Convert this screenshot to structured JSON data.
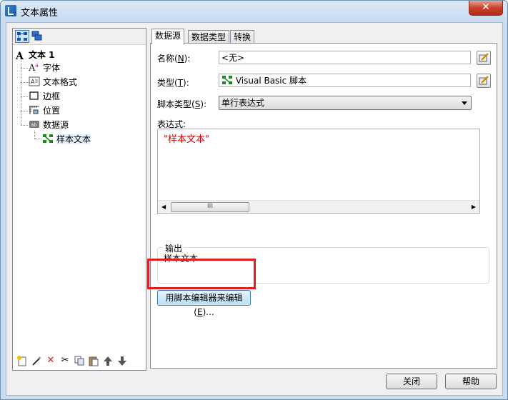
{
  "window": {
    "title": "文本属性",
    "close_glyph": "✕"
  },
  "left_toolbar": {
    "icons": [
      "tree-view-icon",
      "stack-view-icon"
    ]
  },
  "tree": {
    "root": "文本 1",
    "items": [
      {
        "label": "字体",
        "icon": "font-icon"
      },
      {
        "label": "文本格式",
        "icon": "text-format-icon"
      },
      {
        "label": "边框",
        "icon": "border-icon"
      },
      {
        "label": "位置",
        "icon": "position-icon"
      },
      {
        "label": "数据源",
        "icon": "data-source-icon"
      }
    ],
    "child": {
      "label": "样本文本",
      "icon": "script-icon"
    }
  },
  "tabs": [
    "数据源",
    "数据类型",
    "转换"
  ],
  "form": {
    "name_label": "名称(",
    "name_hotkey": "N",
    "name_label_end": "):",
    "name_value": "<无>",
    "type_label": "类型(",
    "type_hotkey": "T",
    "type_label_end": "):",
    "type_value": "Visual Basic 脚本",
    "script_type_label": "脚本类型(",
    "script_type_hotkey": "S",
    "script_type_label_end": "):",
    "script_type_value": "单行表达式",
    "expression_label": "表达式:",
    "expression_value": "\"样本文本\"",
    "scroll_thumb": "III",
    "output_label": "输出",
    "output_value": "样本文本",
    "edit_button": "用脚本编辑器来编辑(",
    "edit_hotkey": "E",
    "edit_button_end": ")..."
  },
  "footer": {
    "close": "关闭",
    "help": "帮助"
  },
  "colors": {
    "highlight": "#e02020",
    "expression_text": "#d00000"
  }
}
